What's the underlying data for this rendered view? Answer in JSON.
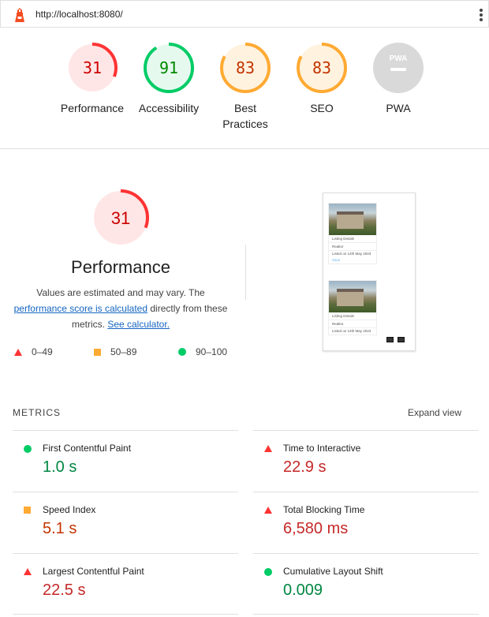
{
  "topbar": {
    "url": "http://localhost:8080/"
  },
  "gauges": [
    {
      "score": "31",
      "label": "Performance",
      "fraction": 0.31,
      "status": "fail"
    },
    {
      "score": "91",
      "label": "Accessibility",
      "fraction": 0.91,
      "status": "pass"
    },
    {
      "score": "83",
      "label": "Best Practices",
      "fraction": 0.83,
      "status": "average"
    },
    {
      "score": "83",
      "label": "SEO",
      "fraction": 0.83,
      "status": "average"
    },
    {
      "score": "",
      "label": "PWA",
      "badge": "PWA",
      "status": "na"
    }
  ],
  "performance": {
    "score": "31",
    "fraction": 0.31,
    "title": "Performance",
    "desc_1": "Values are estimated and may vary. The",
    "desc_link_1": "performance score is calculated",
    "desc_2": "directly from these metrics.",
    "desc_link_2": "See calculator.",
    "legend": [
      {
        "range": "0–49",
        "marker": "triangle"
      },
      {
        "range": "50–89",
        "marker": "square"
      },
      {
        "range": "90–100",
        "marker": "circle"
      }
    ]
  },
  "thumbnail": {
    "card_1": {
      "dropdown_1": "Listing Details",
      "dropdown_2": "Realtor",
      "listed": "Listed on 12th May 2023",
      "link": "Save"
    },
    "card_2": {
      "dropdown_1": "Listing Details",
      "dropdown_2": "Realtor",
      "listed": "Listed on 12th May 2023"
    }
  },
  "metrics": {
    "heading": "METRICS",
    "expand_label": "Expand view",
    "items": [
      {
        "title": "First Contentful Paint",
        "value": "1.0 s",
        "status": "pass"
      },
      {
        "title": "Time to Interactive",
        "value": "22.9 s",
        "status": "fail"
      },
      {
        "title": "Speed Index",
        "value": "5.1 s",
        "status": "average"
      },
      {
        "title": "Total Blocking Time",
        "value": "6,580 ms",
        "status": "fail"
      },
      {
        "title": "Largest Contentful Paint",
        "value": "22.5 s",
        "status": "fail"
      },
      {
        "title": "Cumulative Layout Shift",
        "value": "0.009",
        "status": "pass"
      }
    ]
  },
  "colors": {
    "fail": "#ff3333",
    "fail_bg": "#ffe6e6",
    "fail_text": "#cc0000",
    "average": "#ffaa33",
    "average_bg": "#fff3e0",
    "average_text": "#c33300",
    "pass": "#00cc66",
    "pass_bg": "#e6f9ef",
    "pass_text": "#008800",
    "na": "#cccccc"
  }
}
